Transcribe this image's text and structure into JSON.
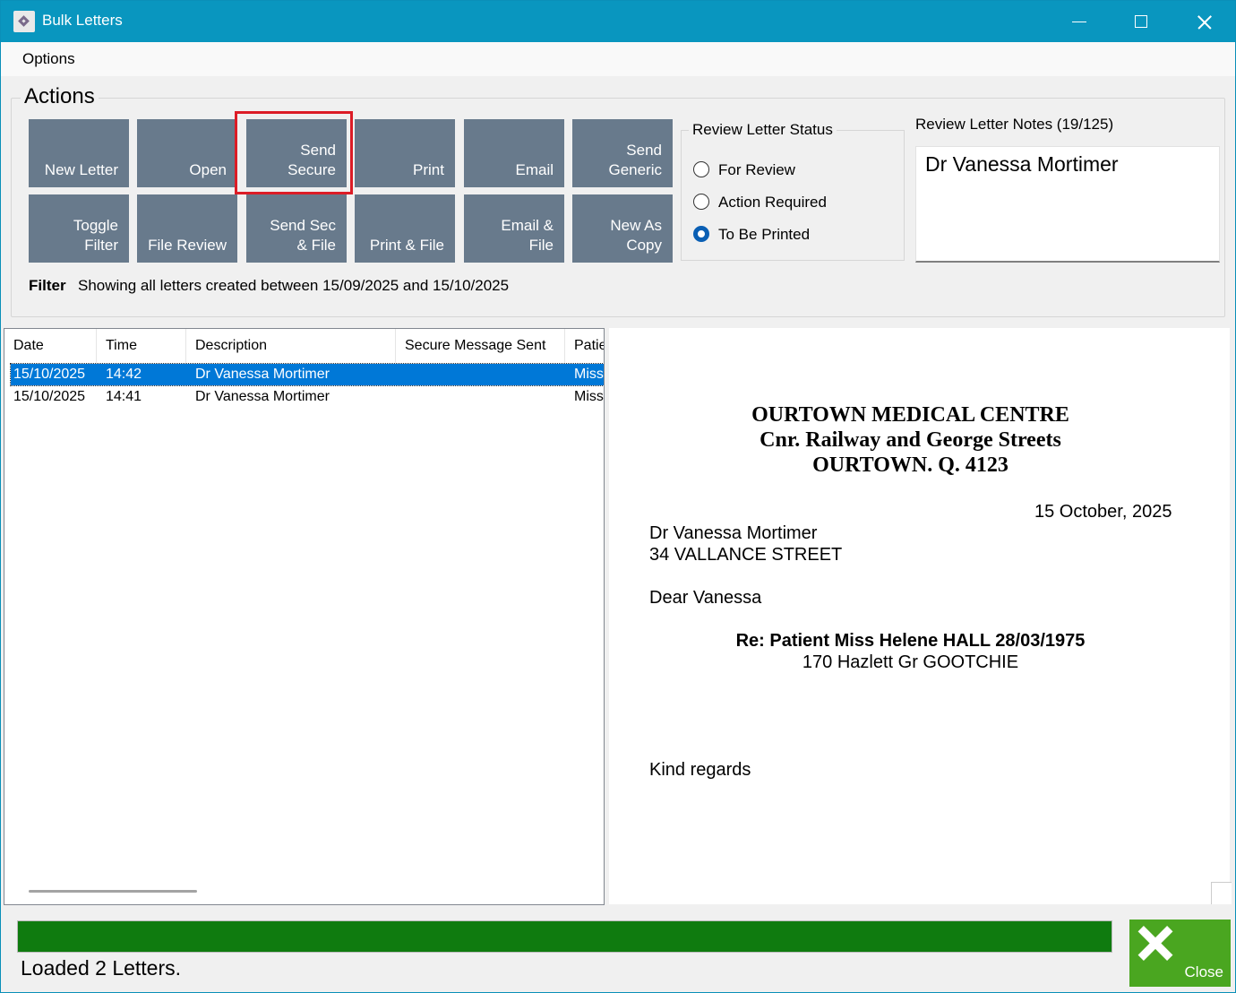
{
  "window": {
    "title": "Bulk Letters"
  },
  "menu": {
    "options": "Options"
  },
  "actions": {
    "label": "Actions",
    "tiles": [
      "New Letter",
      "Open",
      "Send\nSecure",
      "Print",
      "Email",
      "Send\nGeneric",
      "Toggle\nFilter",
      "File Review",
      "Send Sec\n& File",
      "Print & File",
      "Email &\nFile",
      "New As\nCopy"
    ]
  },
  "review_status": {
    "title": "Review Letter Status",
    "options": [
      {
        "label": "For Review",
        "checked": false
      },
      {
        "label": "Action Required",
        "checked": false
      },
      {
        "label": "To Be Printed",
        "checked": true
      }
    ]
  },
  "notes": {
    "title": "Review Letter Notes (19/125)",
    "value": "Dr Vanessa Mortimer"
  },
  "filter": {
    "label": "Filter",
    "text": "Showing all letters created between 15/09/2025 and 15/10/2025"
  },
  "list": {
    "columns": [
      "Date",
      "Time",
      "Description",
      "Secure Message Sent",
      "Patie"
    ],
    "rows": [
      {
        "date": "15/10/2025",
        "time": "14:42",
        "description": "Dr Vanessa Mortimer",
        "secure": "",
        "patient": "Miss",
        "selected": true
      },
      {
        "date": "15/10/2025",
        "time": "14:41",
        "description": "Dr Vanessa Mortimer",
        "secure": "",
        "patient": "Miss",
        "selected": false
      }
    ]
  },
  "preview": {
    "letterhead": [
      "OURTOWN MEDICAL CENTRE",
      "Cnr. Railway and George Streets",
      "OURTOWN. Q. 4123"
    ],
    "date": "15 October, 2025",
    "recipient_name": "Dr Vanessa Mortimer",
    "recipient_address": "34 VALLANCE STREET",
    "salutation": "Dear Vanessa",
    "re_line": "Re: Patient Miss Helene HALL 28/03/1975",
    "re_address": "170 Hazlett Gr GOOTCHIE",
    "signoff": "Kind regards"
  },
  "footer": {
    "progress": 1.0,
    "status": "Loaded 2 Letters.",
    "close_label": "Close"
  },
  "colors": {
    "titlebar": "#0996bf",
    "tile": "#687a8c",
    "progress": "#0f7b0f",
    "close": "#4aa620",
    "highlight": "#dc1c26",
    "selection": "#0078d7"
  }
}
